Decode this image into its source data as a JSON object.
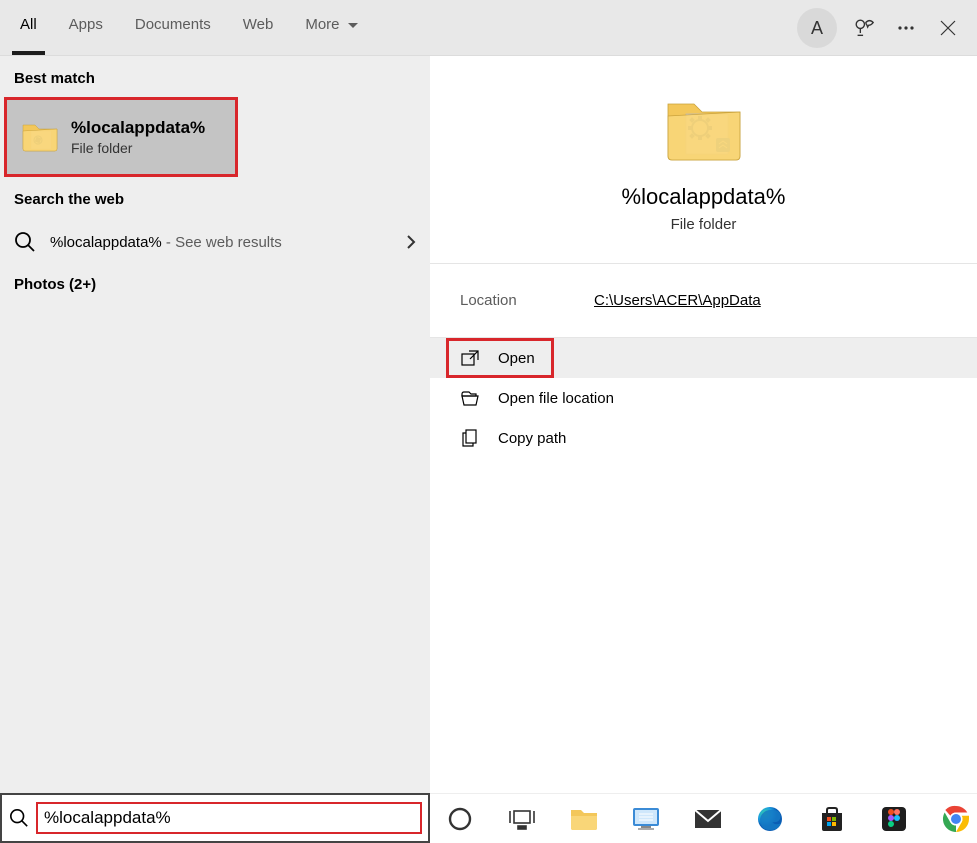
{
  "header": {
    "tabs": {
      "all": "All",
      "apps": "Apps",
      "documents": "Documents",
      "web": "Web",
      "more": "More"
    },
    "avatar_initial": "A"
  },
  "left": {
    "best_match_heading": "Best match",
    "best_match": {
      "title": "%localappdata%",
      "subtitle": "File folder"
    },
    "search_web_heading": "Search the web",
    "web_result": {
      "query": "%localappdata%",
      "suffix": " - See web results"
    },
    "photos_heading": "Photos (2+)"
  },
  "preview": {
    "title": "%localappdata%",
    "subtitle": "File folder",
    "location_label": "Location",
    "location_value": "C:\\Users\\ACER\\AppData",
    "actions": {
      "open": "Open",
      "open_loc": "Open file location",
      "copy_path": "Copy path"
    }
  },
  "search": {
    "value": "%localappdata%"
  }
}
